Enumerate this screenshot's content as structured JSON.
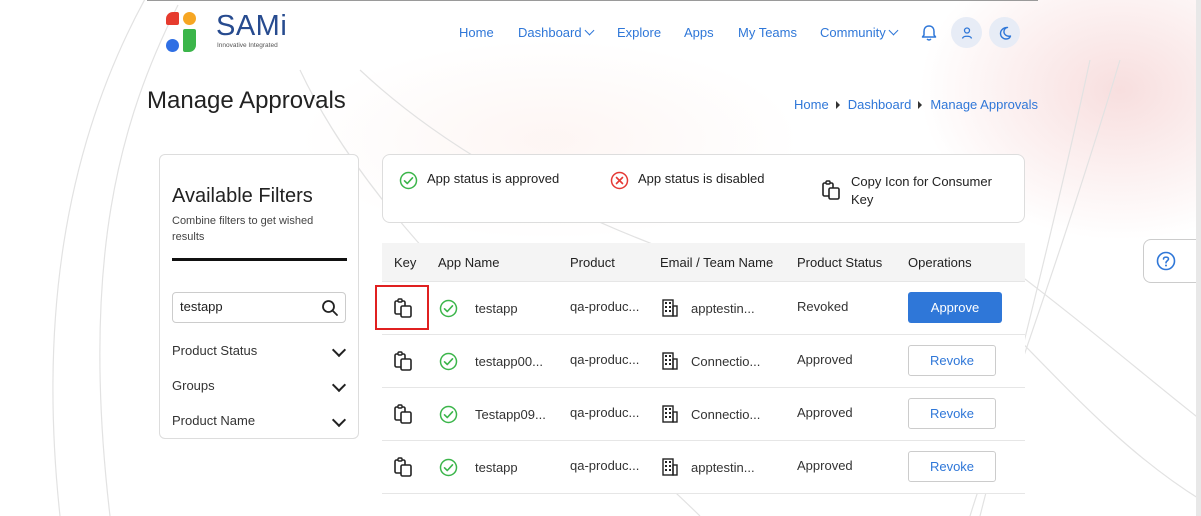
{
  "brand": {
    "name": "SAMi",
    "tagline": "Innovative Integrated"
  },
  "nav": {
    "home": "Home",
    "dashboard": "Dashboard",
    "explore": "Explore",
    "apps": "Apps",
    "my_teams": "My Teams",
    "community": "Community"
  },
  "page": {
    "title": "Manage Approvals"
  },
  "breadcrumb": [
    "Home",
    "Dashboard",
    "Manage Approvals"
  ],
  "filters": {
    "title": "Available Filters",
    "subtitle": "Combine filters to get wished results",
    "search_value": "testapp",
    "items": [
      "Product Status",
      "Groups",
      "Product Name"
    ]
  },
  "legend": {
    "approved": "App status is approved",
    "disabled": "App status is disabled",
    "copy": "Copy Icon for Consumer Key"
  },
  "table": {
    "columns": [
      "Key",
      "App Name",
      "Product",
      "Email / Team Name",
      "Product Status",
      "Operations"
    ],
    "rows": [
      {
        "app": "testapp",
        "product": "qa-produc...",
        "email": "apptestin...",
        "status": "Revoked",
        "action": "Approve"
      },
      {
        "app": "testapp00...",
        "product": "qa-produc...",
        "email": "Connectio...",
        "status": "Approved",
        "action": "Revoke"
      },
      {
        "app": "Testapp09...",
        "product": "qa-produc...",
        "email": "Connectio...",
        "status": "Approved",
        "action": "Revoke"
      },
      {
        "app": "testapp",
        "product": "qa-produc...",
        "email": "apptestin...",
        "status": "Approved",
        "action": "Revoke"
      }
    ]
  },
  "colors": {
    "accent": "#2f77d8",
    "approved": "#3bb54a",
    "disabled": "#e53935",
    "highlight": "#e02020"
  }
}
